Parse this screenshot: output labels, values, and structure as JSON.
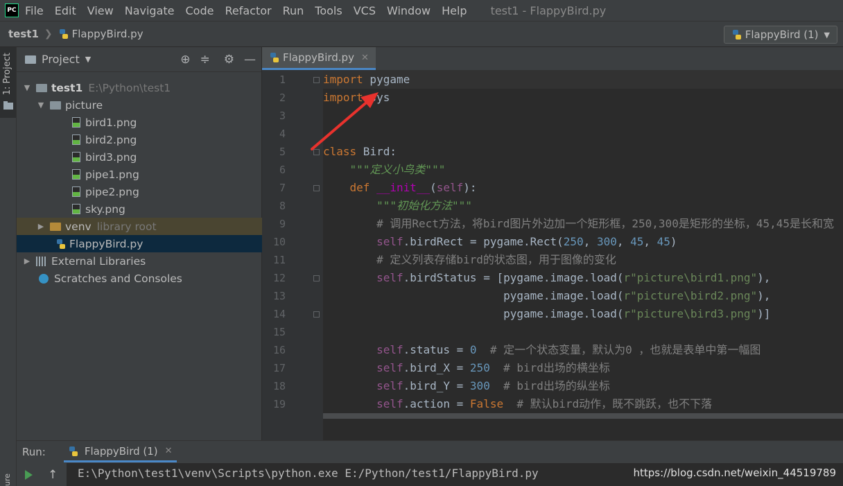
{
  "app": {
    "logo_text": "PC",
    "menu": [
      "File",
      "Edit",
      "View",
      "Navigate",
      "Code",
      "Refactor",
      "Run",
      "Tools",
      "VCS",
      "Window",
      "Help"
    ],
    "window_title": "test1 - FlappyBird.py"
  },
  "breadcrumb": {
    "project": "test1",
    "file": "FlappyBird.py"
  },
  "run_config": {
    "label": "FlappyBird (1)"
  },
  "left_strip": {
    "project_tab": "1: Project",
    "bottom_tab": "ure"
  },
  "project_panel": {
    "title": "Project",
    "tree": {
      "root": {
        "name": "test1",
        "path": "E:\\Python\\test1"
      },
      "picture": "picture",
      "files": [
        "bird1.png",
        "bird2.png",
        "bird3.png",
        "pipe1.png",
        "pipe2.png",
        "sky.png"
      ],
      "venv": {
        "name": "venv",
        "note": "library root"
      },
      "script": "FlappyBird.py",
      "external": "External Libraries",
      "scratches": "Scratches and Consoles"
    }
  },
  "editor": {
    "tab": "FlappyBird.py",
    "line_numbers": [
      "1",
      "2",
      "3",
      "4",
      "5",
      "6",
      "7",
      "8",
      "9",
      "10",
      "11",
      "12",
      "13",
      "14",
      "15",
      "16",
      "17",
      "18",
      "19"
    ],
    "code": {
      "l1_kw": "import",
      "l1_rest": " pygame",
      "l2_kw": "import",
      "l2_rest": " sys",
      "l5_kw": "class",
      "l5_rest": " Bird:",
      "l6": "    \"\"\"定义小鸟类\"\"\"",
      "l7_kw": "    def ",
      "l7_fn": "__init__",
      "l7_a": "(",
      "l7_self": "self",
      "l7_b": "):",
      "l8": "        \"\"\"初始化方法\"\"\"",
      "l9": "        # 调用Rect方法，将bird图片外边加一个矩形框，250,300是矩形的坐标，45,45是长和宽",
      "l10_self": "        self",
      "l10_a": ".birdRect = pygame.Rect(",
      "l10_n1": "250",
      "l10_c1": ", ",
      "l10_n2": "300",
      "l10_c2": ", ",
      "l10_n3": "45",
      "l10_c3": ", ",
      "l10_n4": "45",
      "l10_end": ")",
      "l11": "        # 定义列表存储bird的状态图，用于图像的变化",
      "l12_self": "        self",
      "l12_a": ".birdStatus = [pygame.image.load(",
      "l12_s": "r\"picture\\bird1.png\"",
      "l12_end": "),",
      "l13_a": "                           pygame.image.load(",
      "l13_s": "r\"picture\\bird2.png\"",
      "l13_end": "),",
      "l14_a": "                           pygame.image.load(",
      "l14_s": "r\"picture\\bird3.png\"",
      "l14_end": ")]",
      "l16_self": "        self",
      "l16_a": ".status = ",
      "l16_n": "0",
      "l16_c": "  # 定一个状态变量，默认为0 ，也就是表单中第一幅图",
      "l17_self": "        self",
      "l17_a": ".bird_X = ",
      "l17_n": "250",
      "l17_c": "  # bird出场的横坐标",
      "l18_self": "        self",
      "l18_a": ".bird_Y = ",
      "l18_n": "300",
      "l18_c": "  # bird出场的纵坐标",
      "l19_self": "        self",
      "l19_a": ".action = ",
      "l19_n": "False",
      "l19_c": "  # 默认bird动作，既不跳跃，也不下落"
    }
  },
  "run_panel": {
    "label": "Run:",
    "tab": "FlappyBird (1)",
    "console_line": "E:\\Python\\test1\\venv\\Scripts\\python.exe E:/Python/test1/FlappyBird.py"
  },
  "watermark": "https://blog.csdn.net/weixin_44519789",
  "colors": {
    "background": "#2b2b2b",
    "panel": "#3c3f41",
    "selection": "#0d293e",
    "annotation_arrow": "#e8322d",
    "keyword": "#cc7832"
  }
}
